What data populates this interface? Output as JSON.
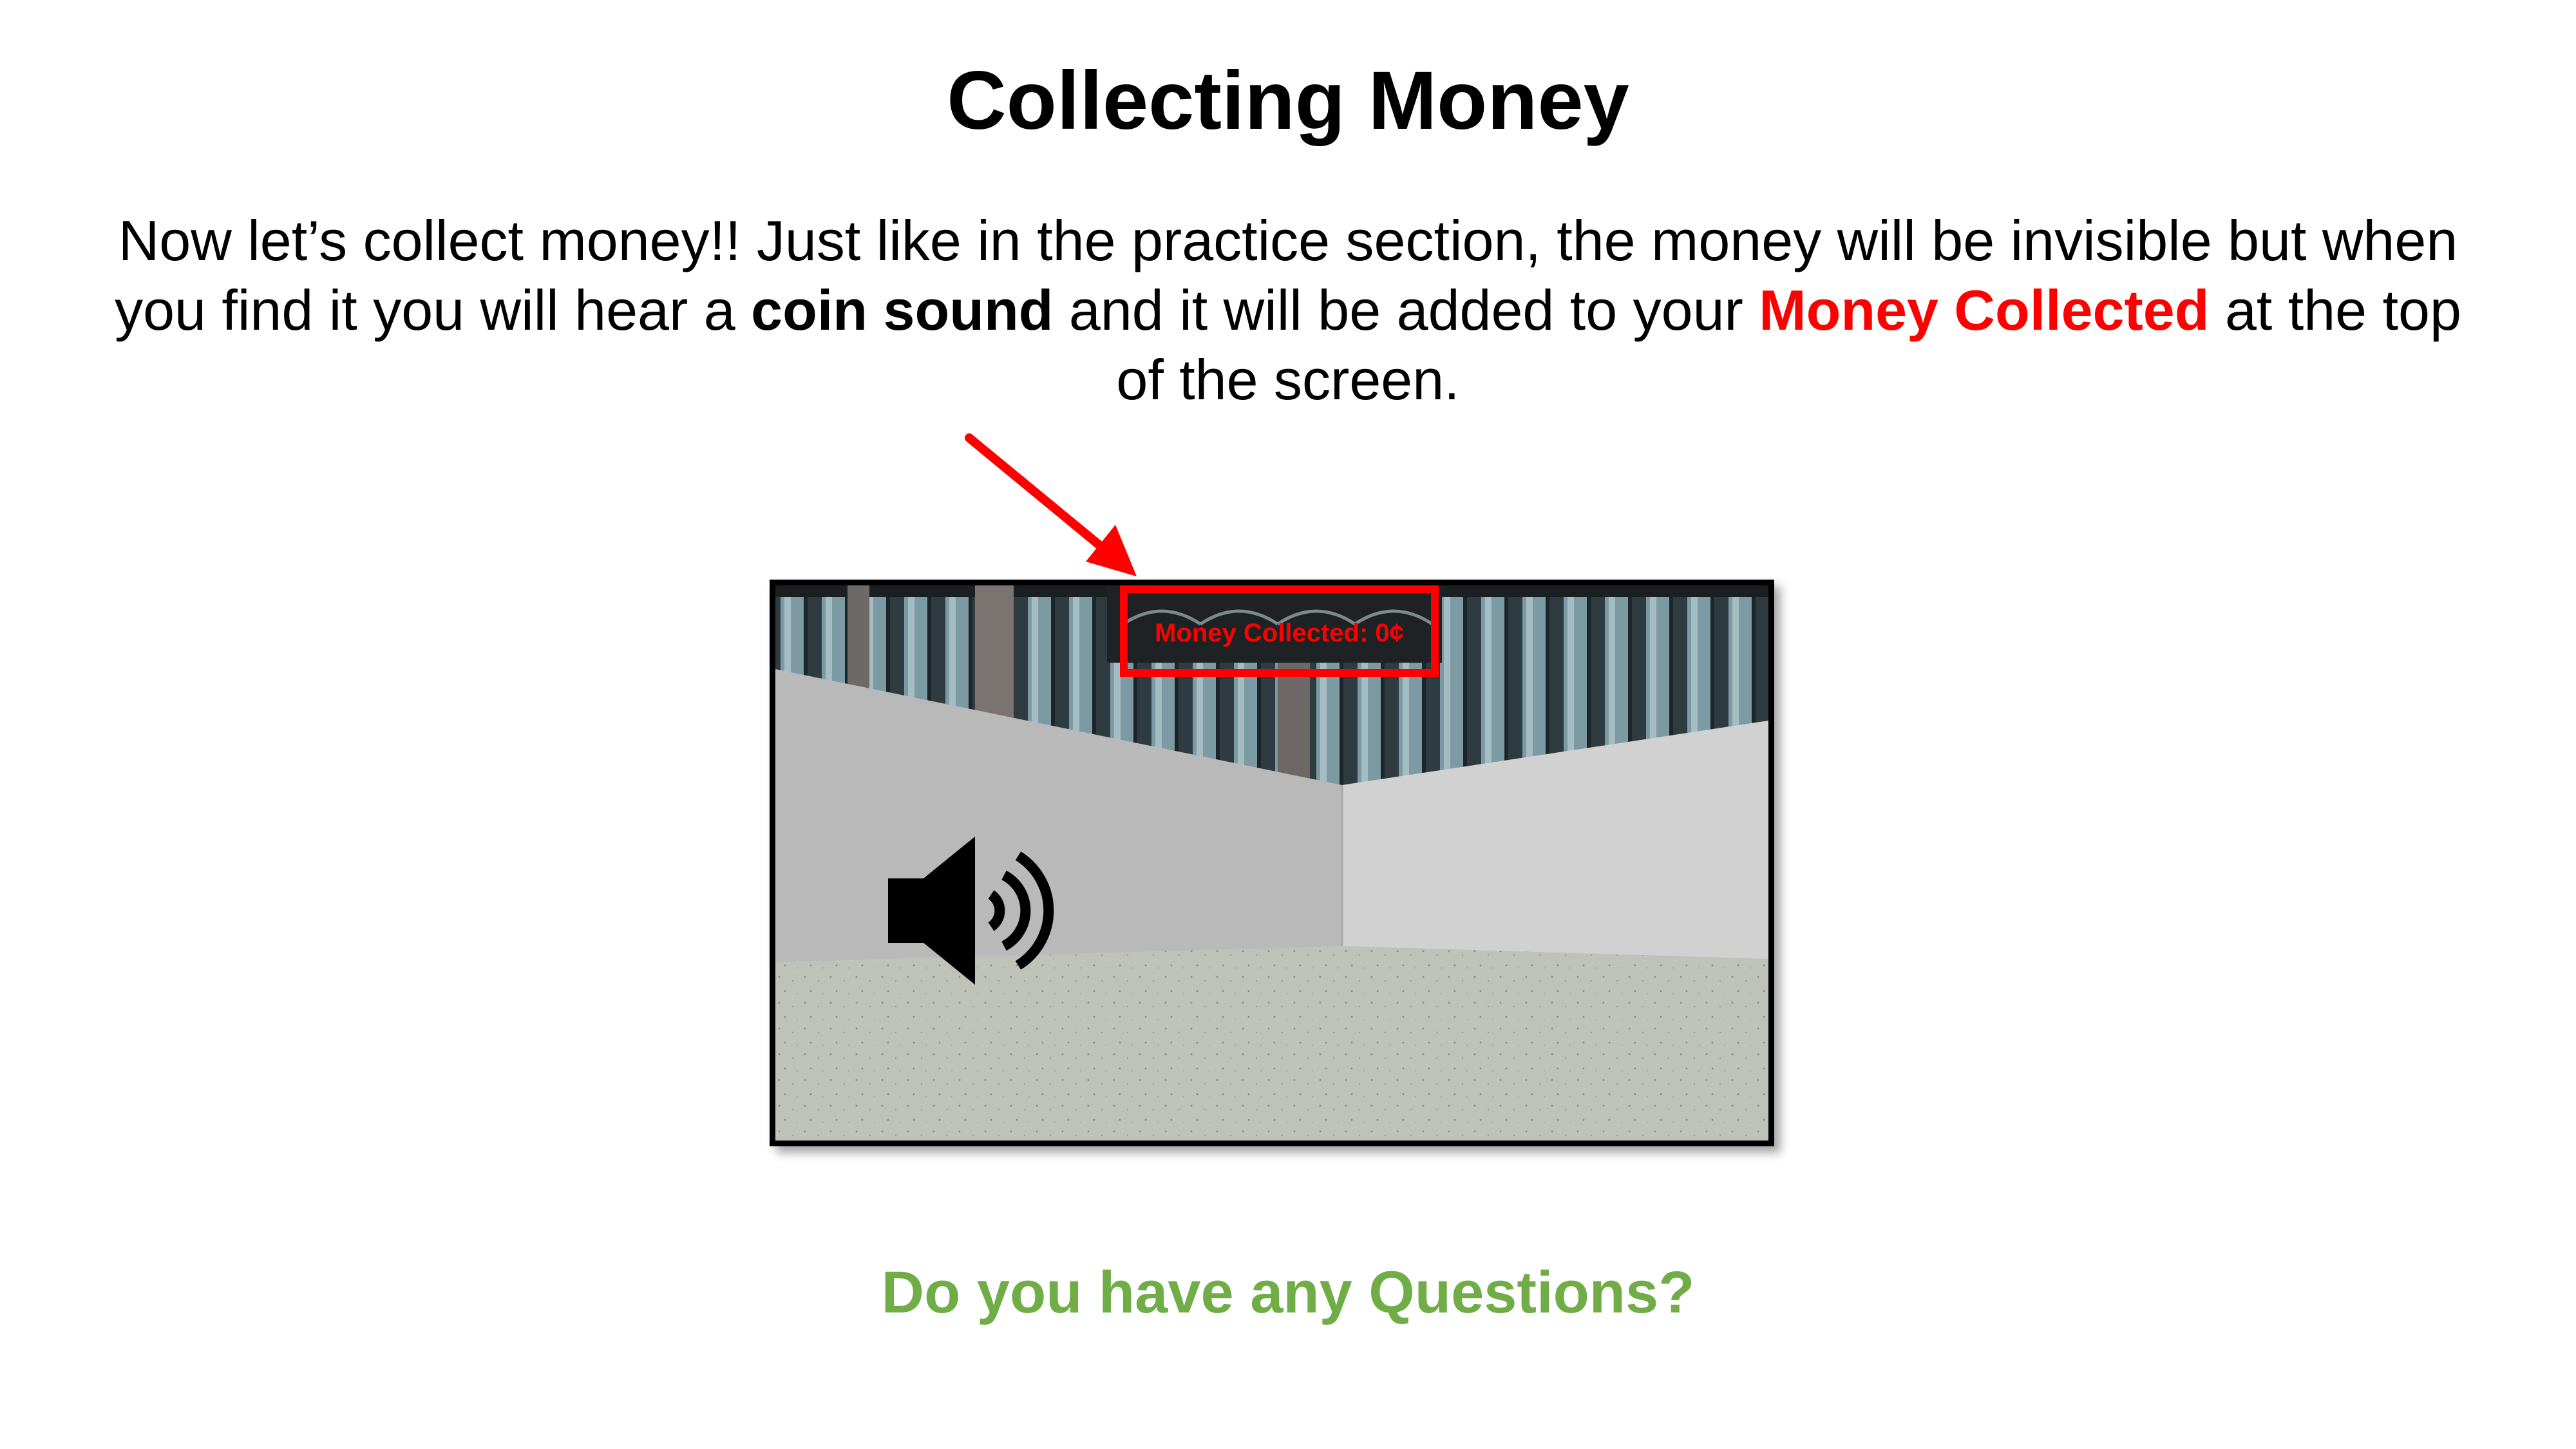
{
  "slide": {
    "title": "Collecting Money",
    "body": {
      "part1": "Now let’s collect money!! Just like in the practice section, the money will be invisible but when you find it you will hear a ",
      "coin_sound": "coin sound",
      "part2": " and it will be added to your ",
      "money_collected": "Money Collected",
      "part3": " at the top of the screen."
    },
    "question": "Do you have any Questions?"
  },
  "game_screenshot": {
    "hud_label": "Money Collected: 0¢"
  },
  "icons": {
    "speaker": "speaker-volume-icon",
    "arrow": "red-arrow-pointer"
  },
  "colors": {
    "highlight_red": "#ff0000",
    "question_green": "#70ad47"
  }
}
